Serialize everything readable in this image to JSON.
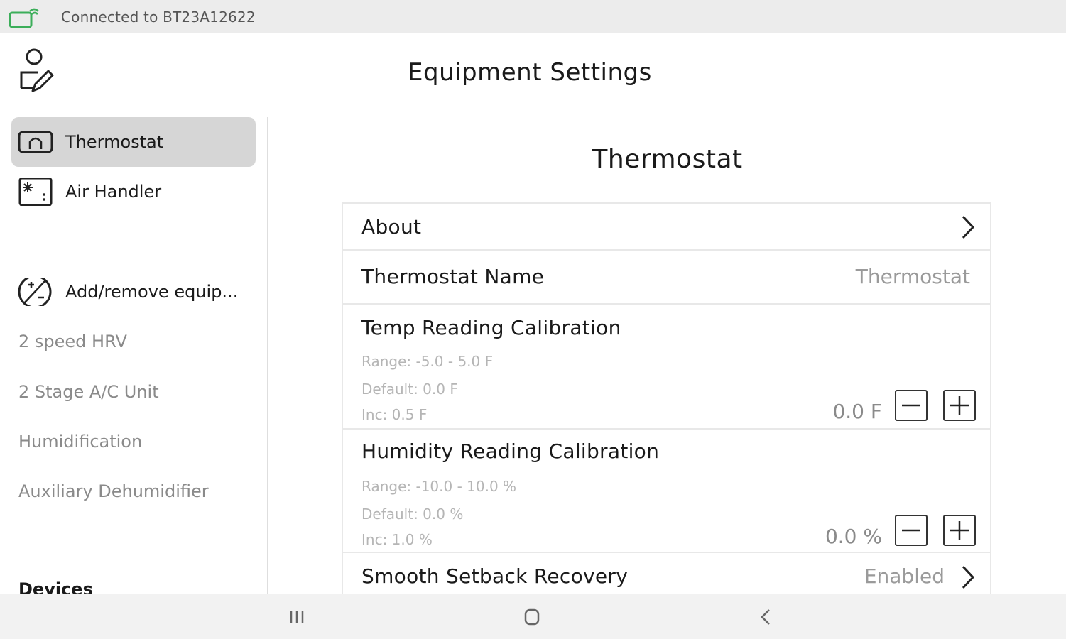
{
  "status_bar": {
    "connection_text": "Connected to BT23A12622",
    "icon": "bluetooth-device-icon"
  },
  "header": {
    "title": "Equipment Settings",
    "profile_icon": "user-edit-icon"
  },
  "sidebar": {
    "items": [
      {
        "label": "Thermostat",
        "icon": "thermostat-icon",
        "selected": true
      },
      {
        "label": "Air Handler",
        "icon": "air-handler-icon",
        "selected": false
      }
    ],
    "add_remove": {
      "label": "Add/remove equip...",
      "icon": "add-remove-icon"
    },
    "accessories": [
      "2 speed HRV",
      "2 Stage A/C Unit",
      "Humidification",
      "Auxiliary Dehumidifier"
    ],
    "section_devices": "Devices"
  },
  "content": {
    "title": "Thermostat",
    "about_label": "About",
    "name_label": "Thermostat Name",
    "name_value": "Thermostat",
    "temp_cal": {
      "title": "Temp Reading Calibration",
      "range": "Range: -5.0 - 5.0 F",
      "default": "Default: 0.0 F",
      "inc": "Inc: 0.5 F",
      "value": "0.0 F"
    },
    "humidity_cal": {
      "title": "Humidity Reading Calibration",
      "range": "Range: -10.0 - 10.0 %",
      "default": "Default: 0.0 %",
      "inc": "Inc: 1.0 %",
      "value": "0.0 %"
    },
    "smooth_setback": {
      "title": "Smooth Setback Recovery",
      "value": "Enabled"
    }
  },
  "nav_bar": {
    "recents_icon": "recents-icon",
    "home_icon": "home-icon",
    "back_icon": "back-icon"
  }
}
